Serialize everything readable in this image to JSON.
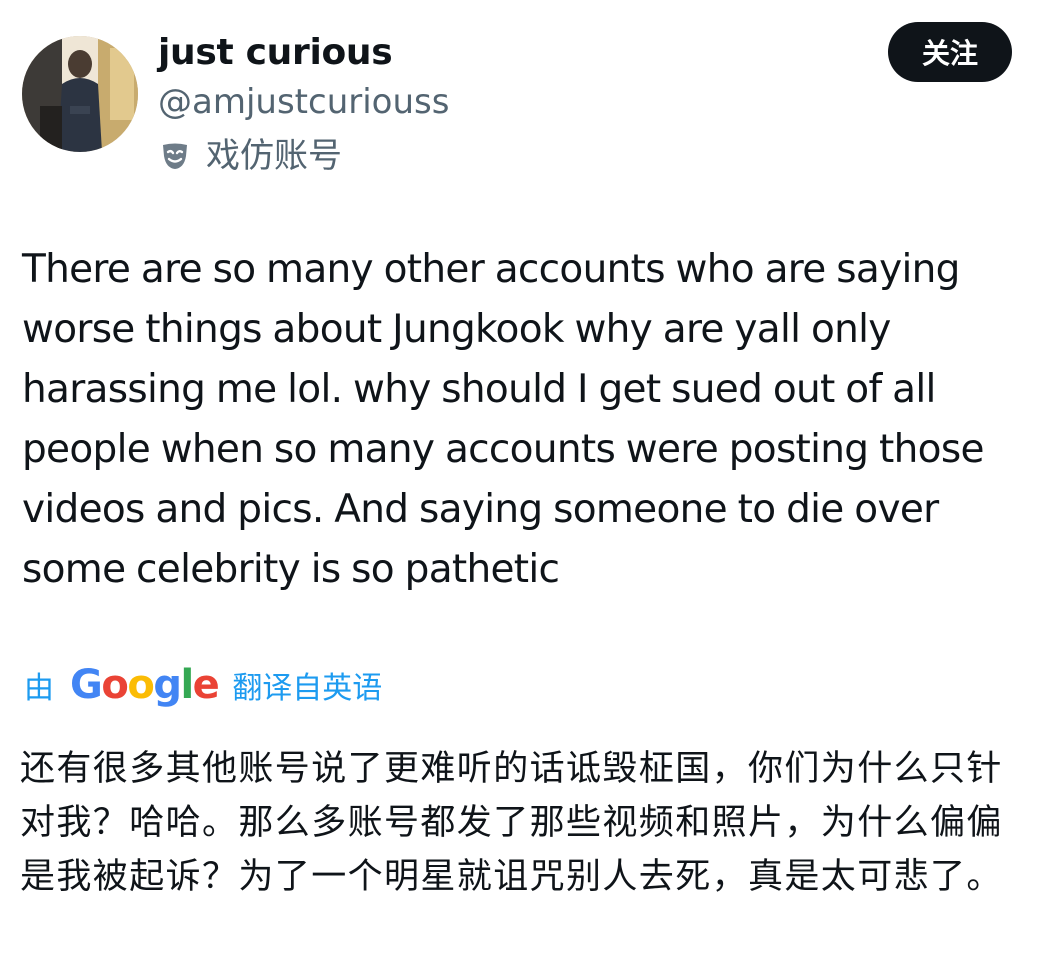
{
  "author": {
    "display_name": "just curious",
    "handle": "@amjustcuriouss",
    "label": "戏仿账号",
    "label_icon": "parody-mask-icon"
  },
  "follow_button": {
    "label": "关注"
  },
  "tweet": {
    "text": "There are so many other accounts who are saying worse things about Jungkook why are yall only harassing me lol. why should I get sued out of all people when so many accounts were posting those videos and pics. And saying someone to die over some celebrity is so pathetic"
  },
  "translation": {
    "by": "由",
    "google_letters": [
      "G",
      "o",
      "o",
      "g",
      "l",
      "e"
    ],
    "translated_from": "翻译自英语",
    "text": "还有很多其他账号说了更难听的话诋毁柾国，你们为什么只针对我？哈哈。那么多账号都发了那些视频和照片，为什么偏偏是我被起诉？为了一个明星就诅咒别人去死，真是太可悲了。"
  },
  "colors": {
    "link": "#1d9bf0",
    "secondary_text": "#536471",
    "primary_text": "#0f1419",
    "google_blue": "#4285f4",
    "google_red": "#ea4335",
    "google_yellow": "#fbbc05",
    "google_green": "#34a853"
  }
}
